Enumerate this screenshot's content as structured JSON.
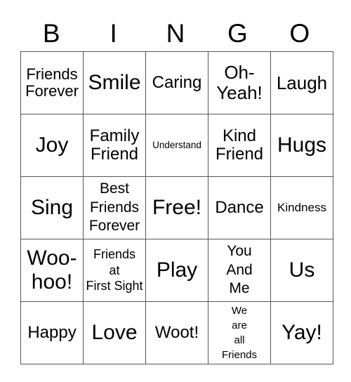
{
  "header": {
    "letters": [
      "B",
      "I",
      "N",
      "G",
      "O"
    ]
  },
  "cells": [
    [
      "Friends Forever",
      "Smile",
      "Caring",
      "Oh- Yeah!",
      "Laugh"
    ],
    [
      "Joy",
      "Family Friend",
      "Understand",
      "Kind Friend",
      "Hugs"
    ],
    [
      "Sing",
      "Best Friends Forever",
      "Free!",
      "Dance",
      "Kindness"
    ],
    [
      "Woo- hoo!",
      "Friends at First Sight",
      "Play",
      "You And Me",
      "Us"
    ],
    [
      "Happy",
      "Love",
      "Woot!",
      "We are all Friends",
      "Yay!"
    ]
  ],
  "cell_lines": {
    "r0c0": [
      "Friends",
      "Forever"
    ],
    "r0c3": [
      "Oh-",
      "Yeah!"
    ],
    "r1c1": [
      "Family",
      "Friend"
    ],
    "r1c3": [
      "Kind",
      "Friend"
    ],
    "r2c1": [
      "Best",
      "Friends",
      "Forever"
    ],
    "r3c0": [
      "Woo-",
      "hoo!"
    ],
    "r3c1": [
      "Friends",
      "at",
      "First Sight"
    ],
    "r3c3": [
      "You",
      "And",
      "Me"
    ],
    "r4c3": [
      "We",
      "are",
      "all",
      "Friends"
    ]
  }
}
